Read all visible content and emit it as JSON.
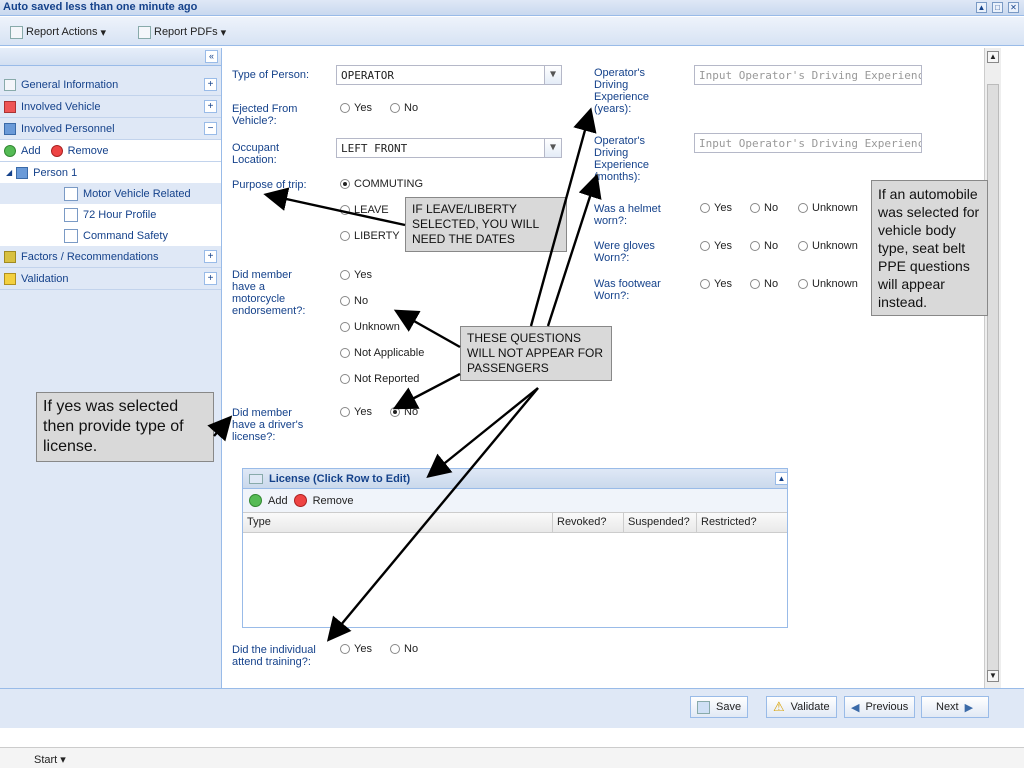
{
  "title": "Auto saved less than one minute ago",
  "toolbar": {
    "report_actions": "Report Actions",
    "report_pdfs": "Report PDFs"
  },
  "nav": {
    "general_information": "General Information",
    "involved_vehicle": "Involved Vehicle",
    "involved_personnel": "Involved Personnel",
    "add": "Add",
    "remove": "Remove",
    "person": "Person 1",
    "sub_items": [
      "Motor Vehicle Related",
      "72 Hour Profile",
      "Command Safety"
    ],
    "factors": "Factors / Recommendations",
    "validation": "Validation"
  },
  "form": {
    "type_of_person_label": "Type of Person:",
    "type_of_person_value": "OPERATOR",
    "ejected_label_1": "Ejected From",
    "ejected_label_2": "Vehicle?:",
    "occupant_label_1": "Occupant",
    "occupant_label_2": "Location:",
    "occupant_value": "LEFT FRONT",
    "purpose_label": "Purpose of trip:",
    "purpose_options": [
      "COMMUTING",
      "LEAVE",
      "LIBERTY"
    ],
    "endorsement_label": [
      "Did member",
      "have a",
      "motorcycle",
      "endorsement?:"
    ],
    "endorsement_options": [
      "Yes",
      "No",
      "Unknown",
      "Not Applicable",
      "Not Reported"
    ],
    "license_label": [
      "Did member",
      "have a driver's",
      "license?:"
    ],
    "training_label": [
      "Did the individual",
      "attend training?:"
    ],
    "yes": "Yes",
    "no": "No",
    "unknown": "Unknown",
    "exp_years_label": [
      "Operator's",
      "Driving",
      "Experience",
      "(years):"
    ],
    "exp_years_placeholder": "Input Operator's Driving Experience (years",
    "exp_months_label": [
      "Operator's",
      "Driving",
      "Experience",
      "(months):"
    ],
    "exp_months_placeholder": "Input Operator's Driving Experience (mont",
    "helmet_label": [
      "Was a helmet",
      "worn?:"
    ],
    "gloves_label": [
      "Were gloves",
      "Worn?:"
    ],
    "footwear_label": [
      "Was footwear",
      "Worn?:"
    ]
  },
  "license_grid": {
    "title": "License (Click Row to Edit)",
    "add": "Add",
    "remove": "Remove",
    "columns": [
      "Type",
      "Revoked?",
      "Suspended?",
      "Restricted?"
    ]
  },
  "buttons": {
    "save": "Save",
    "validate": "Validate",
    "previous": "Previous",
    "next": "Next"
  },
  "start": "Start",
  "annotations": {
    "leave_liberty": "IF LEAVE/LIBERTY SELECTED, YOU WILL NEED THE DATES",
    "passengers": "THESE QUESTIONS WILL NOT APPEAR FOR PASSENGERS",
    "license_type": "If yes was selected then provide type of license.",
    "automobile": "If an automobile was selected for vehicle body type, seat belt PPE questions will appear instead."
  }
}
